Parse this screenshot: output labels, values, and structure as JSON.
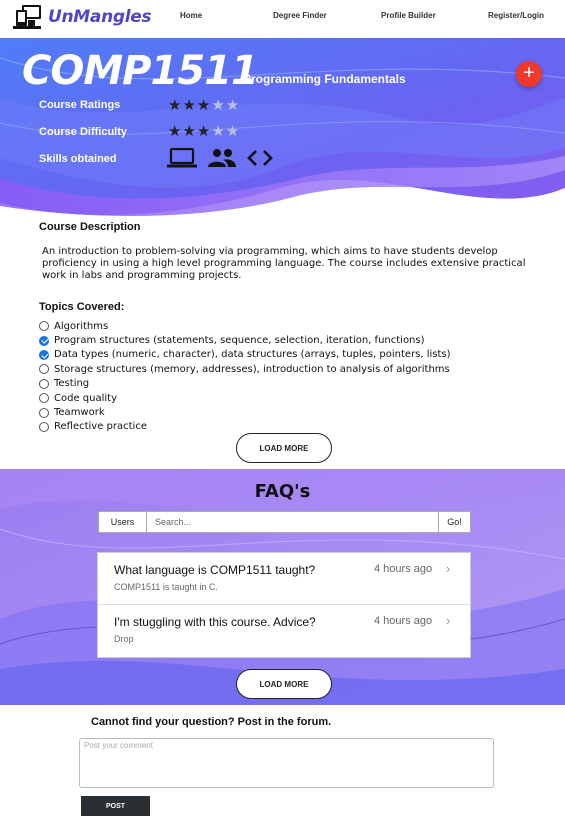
{
  "nav": {
    "brand": "UnMangles",
    "links": [
      "Home",
      "Degree Finder",
      "Profile Builder",
      "Register/Login"
    ]
  },
  "hero": {
    "course_code": "COMP1511",
    "course_name": "Programming Fundamentals",
    "add_button_icon": "plus-icon",
    "ratings_label": "Course Ratings",
    "ratings_value": 3,
    "difficulty_label": "Course Difficulty",
    "difficulty_value": 3,
    "stars_max": 5,
    "skills_label": "Skills obtained",
    "skills_icons": [
      "laptop-icon",
      "people-icon",
      "code-icon"
    ]
  },
  "description": {
    "title": "Course Description",
    "text": "An introduction to problem-solving via programming, which aims to have students develop proficiency in using a high level programming language. The course includes extensive practical work in labs and programming projects."
  },
  "topics": {
    "title": "Topics Covered:",
    "items": [
      {
        "label": "Algorithms",
        "checked": false
      },
      {
        "label": "Program structures (statements, sequence, selection, iteration, functions)",
        "checked": true
      },
      {
        "label": "Data types (numeric, character), data structures (arrays, tuples, pointers, lists)",
        "checked": true
      },
      {
        "label": "Storage structures (memory, addresses), introduction to analysis of algorithms",
        "checked": false
      },
      {
        "label": "Testing",
        "checked": false
      },
      {
        "label": "Code quality",
        "checked": false
      },
      {
        "label": "Teamwork",
        "checked": false
      },
      {
        "label": "Reflective practice",
        "checked": false
      }
    ],
    "load_more": "LOAD MORE"
  },
  "faq": {
    "title": "FAQ's",
    "search_scope": "Users",
    "search_placeholder": "Search...",
    "search_go": "Go!",
    "items": [
      {
        "question": "What language is COMP1511 taught?",
        "answer": "COMP1511 is taught in C.",
        "time": "4 hours ago"
      },
      {
        "question": "I'm stuggling with this course. Advice?",
        "answer": "Drop",
        "time": "4 hours ago"
      }
    ],
    "load_more": "LOAD MORE"
  },
  "forum": {
    "title": "Cannot find your question? Post in the forum.",
    "comment_placeholder": "Post your comment",
    "post_button": "POST"
  },
  "colors": {
    "brand": "#4f46c8",
    "hero_blue": "#5b6cf5",
    "hero_purple": "#8b5cf6",
    "faq_purple": "#a58cf0",
    "fab_red": "#f0392b",
    "check_blue": "#1a73e8",
    "post_button_bg": "#2a2f33"
  }
}
